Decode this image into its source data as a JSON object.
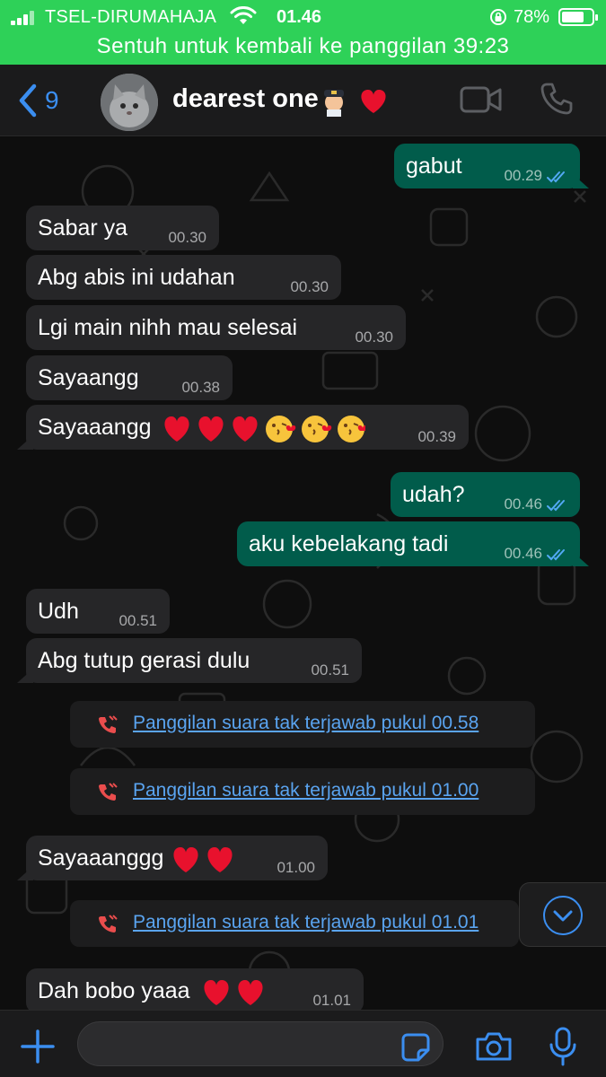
{
  "status_bar": {
    "carrier": "TSEL-DIRUMAHAJA",
    "time": "01.46",
    "battery": "78%",
    "call_banner": "Sentuh untuk kembali ke panggilan 39:23"
  },
  "header": {
    "back_count": "9",
    "contact_name": "dearest one",
    "contact_emoji": [
      "pilot-emoji",
      "heart-emoji"
    ]
  },
  "colors": {
    "status_green": "#2ed158",
    "incoming_bubble": "#262628",
    "outgoing_bubble": "#015c4b",
    "link_blue": "#5aa4f0",
    "accent_blue": "#3b8ef0",
    "missed_call_red": "#ea4d4d"
  },
  "messages": [
    {
      "dir": "out",
      "text": "gabut",
      "time": "00.29",
      "read": true
    },
    {
      "dir": "in",
      "text": "Sabar ya",
      "time": "00.30"
    },
    {
      "dir": "in",
      "text": "Abg abis ini udahan",
      "time": "00.30"
    },
    {
      "dir": "in",
      "text": "Lgi main nihh mau selesai",
      "time": "00.30"
    },
    {
      "dir": "in",
      "text": "Sayaangg",
      "time": "00.38"
    },
    {
      "dir": "in",
      "text": "Sayaaangg",
      "emoji": [
        "heart",
        "heart",
        "heart",
        "kiss",
        "kiss",
        "kiss"
      ],
      "time": "00.39"
    },
    {
      "dir": "out",
      "text": "udah?",
      "time": "00.46",
      "read": true
    },
    {
      "dir": "out",
      "text": "aku kebelakang tadi",
      "time": "00.46",
      "read": true
    },
    {
      "dir": "in",
      "text": "Udh",
      "time": "00.51"
    },
    {
      "dir": "in",
      "text": "Abg tutup gerasi dulu",
      "time": "00.51"
    },
    {
      "dir": "sys",
      "text": "Panggilan suara tak terjawab pukul 00.58"
    },
    {
      "dir": "sys",
      "text": "Panggilan suara tak terjawab pukul 01.00"
    },
    {
      "dir": "in",
      "text": "Sayaaanggg",
      "emoji": [
        "heart",
        "heart"
      ],
      "time": "01.00"
    },
    {
      "dir": "sys",
      "text": "Panggilan suara tak terjawab pukul 01.01"
    },
    {
      "dir": "in",
      "text": "Dah bobo yaaa",
      "emoji": [
        "heart",
        "heart"
      ],
      "time": "01.01"
    }
  ],
  "input": {
    "placeholder": ""
  }
}
